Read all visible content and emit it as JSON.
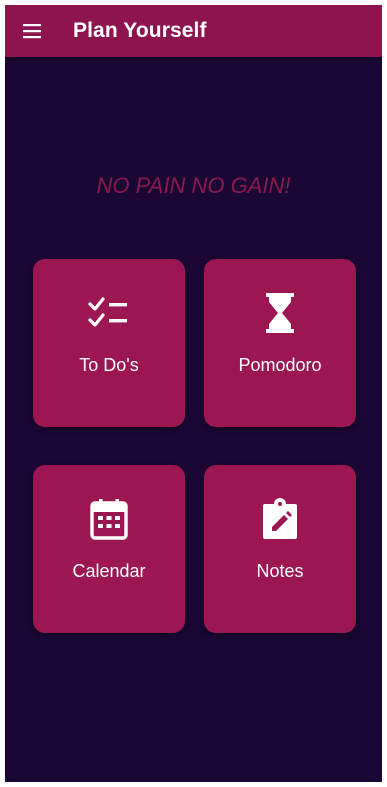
{
  "app_bar": {
    "title": "Plan Yourself",
    "menu_icon": "hamburger-menu-icon",
    "background": "#8e1450"
  },
  "motto": {
    "text": "NO PAIN NO GAIN!",
    "color": "#8c1850"
  },
  "screen": {
    "background": "#1a0733"
  },
  "tiles": [
    {
      "label": "To Do's",
      "icon": "checklist-icon"
    },
    {
      "label": "Pomodoro",
      "icon": "hourglass-icon"
    },
    {
      "label": "Calendar",
      "icon": "calendar-icon"
    },
    {
      "label": "Notes",
      "icon": "clipboard-edit-icon"
    }
  ],
  "tile_color": "#9c1752"
}
